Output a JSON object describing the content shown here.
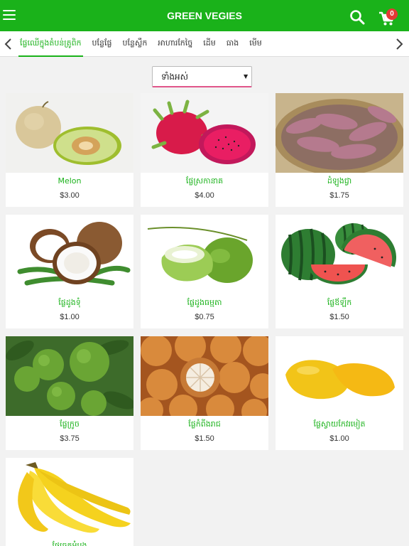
{
  "header": {
    "title": "GREEN VEGIES",
    "menu_icon": "hamburger-icon",
    "search_icon": "search-icon",
    "cart_icon": "cart-icon",
    "cart_count": "0",
    "background_color": "#1ab21a",
    "badge_color": "#e53935"
  },
  "category_tabs": {
    "left_icon": "chevron-left-icon",
    "right_icon": "chevron-right-icon",
    "items": [
      {
        "label": "ផ្លែឈើក្នុងតំបន់ត្រូពិក",
        "active": true
      },
      {
        "label": "បន្លែផ្លែ",
        "active": false
      },
      {
        "label": "បន្លែស្លឹក",
        "active": false
      },
      {
        "label": "អាហារកែច្នៃ",
        "active": false
      },
      {
        "label": "ដើម",
        "active": false
      },
      {
        "label": "ធាង",
        "active": false
      },
      {
        "label": "មើម",
        "active": false
      }
    ]
  },
  "filter": {
    "selected": "ទាំងអស់",
    "caret": "▼"
  },
  "products": [
    {
      "name": "Melon",
      "price": "$3.00",
      "image": "melon"
    },
    {
      "name": "ផ្លែស្រកានាគ",
      "price": "$4.00",
      "image": "dragon-fruit"
    },
    {
      "name": "ដំឡូងជ្វា",
      "price": "$1.75",
      "image": "sweet-potato"
    },
    {
      "name": "ផ្លែដូងទុំ",
      "price": "$1.00",
      "image": "coconut"
    },
    {
      "name": "ផ្លែដូងធម្មតា",
      "price": "$0.75",
      "image": "green-coconut"
    },
    {
      "name": "ផ្លែឪឡឹក",
      "price": "$1.50",
      "image": "watermelon"
    },
    {
      "name": "ផ្លែក្រូច",
      "price": "$3.75",
      "image": "lime"
    },
    {
      "name": "ផ្លែកំពីងរាជ",
      "price": "$1.50",
      "image": "santol"
    },
    {
      "name": "ផ្លែស្វាយកែវរមៀត",
      "price": "$1.00",
      "image": "mango"
    },
    {
      "name": "ផ្លែចេកអំបូង",
      "price": "",
      "image": "banana"
    }
  ]
}
